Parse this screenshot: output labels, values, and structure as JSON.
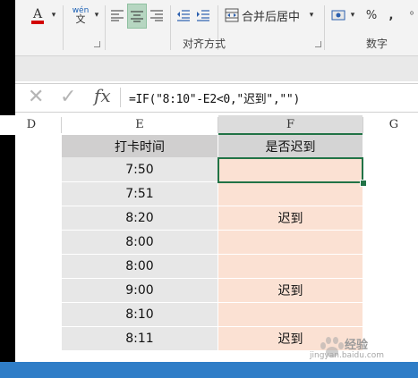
{
  "ribbon": {
    "merge_center": "合并后居中",
    "percent": "%",
    "comma": ",",
    "phonetic_top": "wén",
    "phonetic_bottom": "文",
    "group_alignment": "对齐方式",
    "group_number": "数字"
  },
  "formula_bar": {
    "cancel": "✕",
    "enter": "✓",
    "fx": "fx",
    "formula": "=IF(\"8:10\"-E2<0,\"迟到\",\"\")"
  },
  "columns": [
    "D",
    "E",
    "F",
    "G"
  ],
  "table": {
    "headers": [
      "打卡时间",
      "是否迟到"
    ],
    "rows": [
      {
        "time": "7:50",
        "late": ""
      },
      {
        "time": "7:51",
        "late": ""
      },
      {
        "time": "8:20",
        "late": "迟到"
      },
      {
        "time": "8:00",
        "late": ""
      },
      {
        "time": "8:00",
        "late": ""
      },
      {
        "time": "9:00",
        "late": "迟到"
      },
      {
        "time": "8:10",
        "late": ""
      },
      {
        "time": "8:11",
        "late": "迟到"
      }
    ]
  },
  "watermark": {
    "brand": "经验",
    "url": "jingyan.baidu.com"
  },
  "colors": {
    "excel_green": "#217346",
    "late_fill": "#fbe1d3",
    "status_bar": "#2f7dc7"
  }
}
